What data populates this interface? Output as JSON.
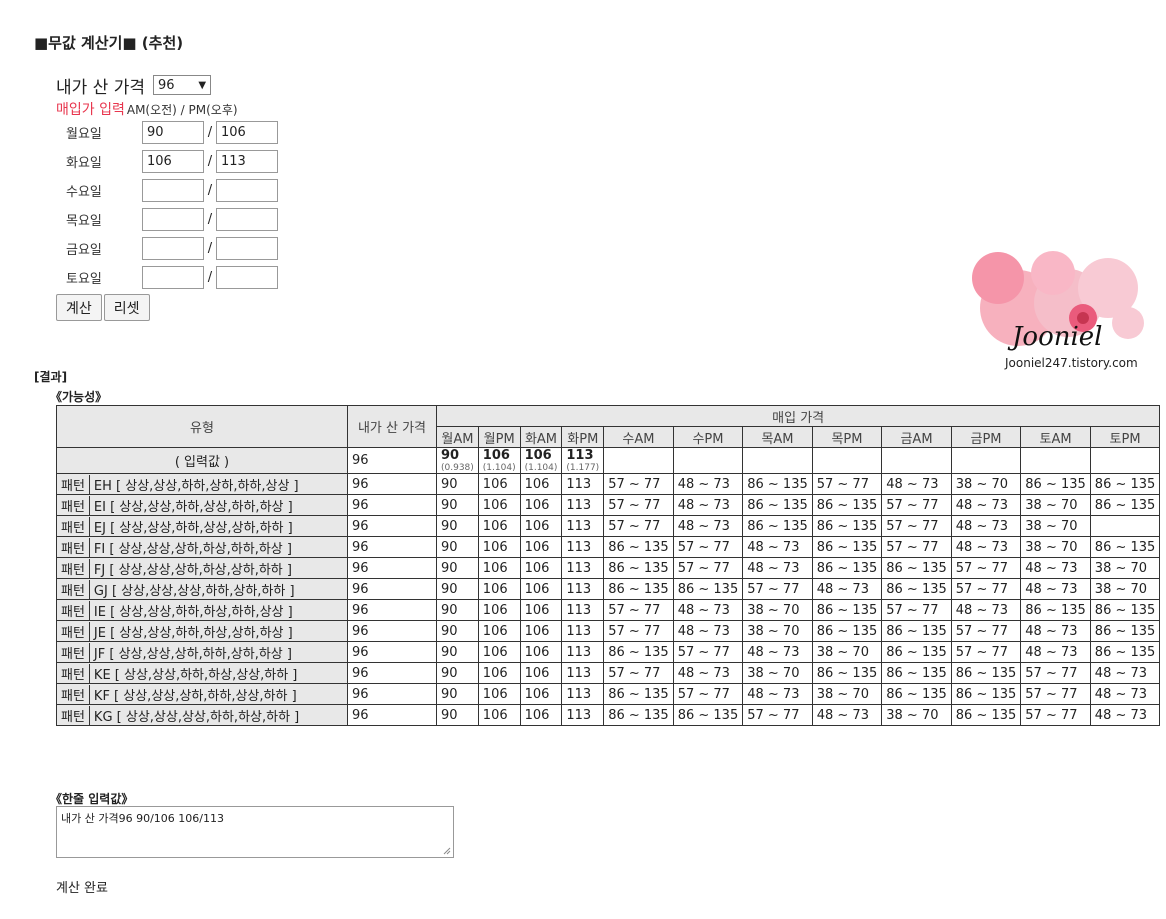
{
  "title": "■무값 계산기■ (추천)",
  "form": {
    "my_price_label": "내가 산 가격",
    "my_price_value": "96",
    "purchase_label": "매입가 입력",
    "ampm_label": "AM(오전) / PM(오후)",
    "days": [
      {
        "label": "월요일",
        "am": "90",
        "pm": "106"
      },
      {
        "label": "화요일",
        "am": "106",
        "pm": "113"
      },
      {
        "label": "수요일",
        "am": "",
        "pm": ""
      },
      {
        "label": "목요일",
        "am": "",
        "pm": ""
      },
      {
        "label": "금요일",
        "am": "",
        "pm": ""
      },
      {
        "label": "토요일",
        "am": "",
        "pm": ""
      }
    ],
    "calc_button": "계산",
    "reset_button": "리셋"
  },
  "logo": {
    "signature": "Jooniel",
    "url": "Jooniel247.tistory.com"
  },
  "result_label": "[결과]",
  "possibility_label": "《가능성》",
  "table": {
    "h_type": "유형",
    "h_mine": "내가 산 가격",
    "h_buy": "매입 가격",
    "cols": [
      "월AM",
      "월PM",
      "화AM",
      "화PM",
      "수AM",
      "수PM",
      "목AM",
      "목PM",
      "금AM",
      "금PM",
      "토AM",
      "토PM"
    ],
    "input_label": "( 입력값 )",
    "input_mine": "96",
    "input_vals": [
      {
        "v": "90",
        "r": "(0.938)"
      },
      {
        "v": "106",
        "r": "(1.104)"
      },
      {
        "v": "106",
        "r": "(1.104)"
      },
      {
        "v": "113",
        "r": "(1.177)"
      }
    ],
    "rows": [
      {
        "p": "패턴",
        "name": "EH [ 상상,상상,하하,상하,하하,상상 ]",
        "mine": "96",
        "v": [
          "90",
          "106",
          "106",
          "113",
          "57 ~ 77",
          "48 ~ 73",
          "86 ~ 135",
          "57 ~ 77",
          "48 ~ 73",
          "38 ~ 70",
          "86 ~ 135",
          "86 ~ 135"
        ]
      },
      {
        "p": "패턴",
        "name": "EI [ 상상,상상,하하,상상,하하,하상 ]",
        "mine": "96",
        "v": [
          "90",
          "106",
          "106",
          "113",
          "57 ~ 77",
          "48 ~ 73",
          "86 ~ 135",
          "86 ~ 135",
          "57 ~ 77",
          "48 ~ 73",
          "38 ~ 70",
          "86 ~ 135"
        ]
      },
      {
        "p": "패턴",
        "name": "EJ [ 상상,상상,하하,상상,상하,하하 ]",
        "mine": "96",
        "v": [
          "90",
          "106",
          "106",
          "113",
          "57 ~ 77",
          "48 ~ 73",
          "86 ~ 135",
          "86 ~ 135",
          "57 ~ 77",
          "48 ~ 73",
          "38 ~ 70"
        ]
      },
      {
        "p": "패턴",
        "name": "FI [ 상상,상상,상하,하상,하하,하상 ]",
        "mine": "96",
        "v": [
          "90",
          "106",
          "106",
          "113",
          "86 ~ 135",
          "57 ~ 77",
          "48 ~ 73",
          "86 ~ 135",
          "57 ~ 77",
          "48 ~ 73",
          "38 ~ 70",
          "86 ~ 135"
        ]
      },
      {
        "p": "패턴",
        "name": "FJ [ 상상,상상,상하,하상,상하,하하 ]",
        "mine": "96",
        "v": [
          "90",
          "106",
          "106",
          "113",
          "86 ~ 135",
          "57 ~ 77",
          "48 ~ 73",
          "86 ~ 135",
          "86 ~ 135",
          "57 ~ 77",
          "48 ~ 73",
          "38 ~ 70"
        ]
      },
      {
        "p": "패턴",
        "name": "GJ [ 상상,상상,상상,하하,상하,하하 ]",
        "mine": "96",
        "v": [
          "90",
          "106",
          "106",
          "113",
          "86 ~ 135",
          "86 ~ 135",
          "57 ~ 77",
          "48 ~ 73",
          "86 ~ 135",
          "57 ~ 77",
          "48 ~ 73",
          "38 ~ 70"
        ]
      },
      {
        "p": "패턴",
        "name": "IE [ 상상,상상,하하,하상,하하,상상 ]",
        "mine": "96",
        "v": [
          "90",
          "106",
          "106",
          "113",
          "57 ~ 77",
          "48 ~ 73",
          "38 ~ 70",
          "86 ~ 135",
          "57 ~ 77",
          "48 ~ 73",
          "86 ~ 135",
          "86 ~ 135"
        ]
      },
      {
        "p": "패턴",
        "name": "JE [ 상상,상상,하하,하상,상하,하상 ]",
        "mine": "96",
        "v": [
          "90",
          "106",
          "106",
          "113",
          "57 ~ 77",
          "48 ~ 73",
          "38 ~ 70",
          "86 ~ 135",
          "86 ~ 135",
          "57 ~ 77",
          "48 ~ 73",
          "86 ~ 135"
        ]
      },
      {
        "p": "패턴",
        "name": "JF [ 상상,상상,상하,하하,상하,하상 ]",
        "mine": "96",
        "v": [
          "90",
          "106",
          "106",
          "113",
          "86 ~ 135",
          "57 ~ 77",
          "48 ~ 73",
          "38 ~ 70",
          "86 ~ 135",
          "57 ~ 77",
          "48 ~ 73",
          "86 ~ 135"
        ]
      },
      {
        "p": "패턴",
        "name": "KE [ 상상,상상,하하,하상,상상,하하 ]",
        "mine": "96",
        "v": [
          "90",
          "106",
          "106",
          "113",
          "57 ~ 77",
          "48 ~ 73",
          "38 ~ 70",
          "86 ~ 135",
          "86 ~ 135",
          "86 ~ 135",
          "57 ~ 77",
          "48 ~ 73"
        ]
      },
      {
        "p": "패턴",
        "name": "KF [ 상상,상상,상하,하하,상상,하하 ]",
        "mine": "96",
        "v": [
          "90",
          "106",
          "106",
          "113",
          "86 ~ 135",
          "57 ~ 77",
          "48 ~ 73",
          "38 ~ 70",
          "86 ~ 135",
          "86 ~ 135",
          "57 ~ 77",
          "48 ~ 73"
        ]
      },
      {
        "p": "패턴",
        "name": "KG [ 상상,상상,상상,하하,하상,하하 ]",
        "mine": "96",
        "v": [
          "90",
          "106",
          "106",
          "113",
          "86 ~ 135",
          "86 ~ 135",
          "57 ~ 77",
          "48 ~ 73",
          "38 ~ 70",
          "86 ~ 135",
          "57 ~ 77",
          "48 ~ 73"
        ]
      }
    ]
  },
  "oneline_label": "《한줄 입력값》",
  "oneline_value": "내가 산 가격96 90/106 106/113",
  "status": "계산 완료"
}
